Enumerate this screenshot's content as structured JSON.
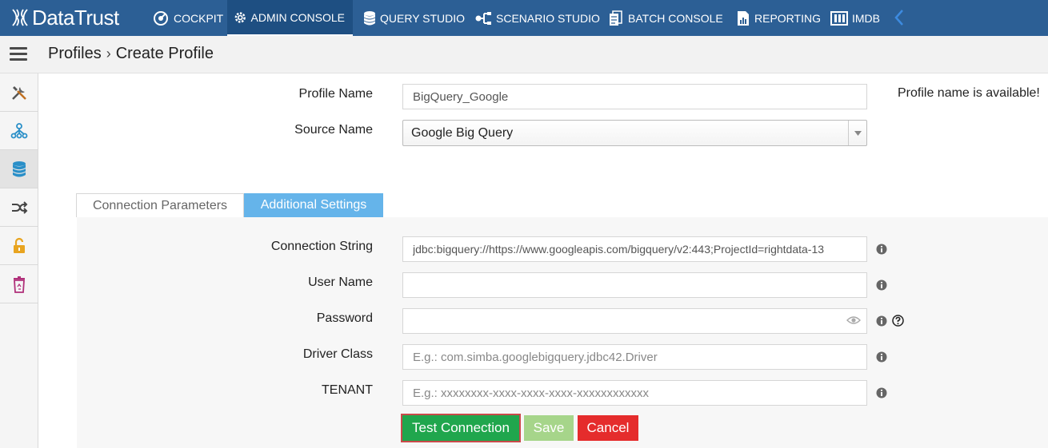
{
  "app": {
    "name": "DataTrust"
  },
  "nav": {
    "items": [
      {
        "label": "COCKPIT",
        "icon": "cockpit-icon",
        "active": false
      },
      {
        "label": "ADMIN CONSOLE",
        "icon": "gear-icon",
        "active": true
      },
      {
        "label": "QUERY STUDIO",
        "icon": "database-icon",
        "active": false
      },
      {
        "label": "SCENARIO STUDIO",
        "icon": "scenario-icon",
        "active": false
      },
      {
        "label": "BATCH CONSOLE",
        "icon": "batch-icon",
        "active": false
      },
      {
        "label": "REPORTING",
        "icon": "report-icon",
        "active": false
      },
      {
        "label": "IMDB",
        "icon": "imdb-icon",
        "active": false
      }
    ]
  },
  "breadcrumb": {
    "parent": "Profiles",
    "separator": "›",
    "current": "Create Profile"
  },
  "sidebar": {
    "items": [
      {
        "icon": "tools-icon"
      },
      {
        "icon": "network-icon"
      },
      {
        "icon": "database-icon",
        "active": true
      },
      {
        "icon": "shuffle-icon"
      },
      {
        "icon": "unlock-icon"
      },
      {
        "icon": "recycle-bin-icon"
      }
    ]
  },
  "form": {
    "profile_name": {
      "label": "Profile Name",
      "value": "BigQuery_Google",
      "status": "Profile name is available!"
    },
    "source_name": {
      "label": "Source Name",
      "value": "Google Big Query"
    }
  },
  "tabs": [
    {
      "label": "Connection Parameters",
      "active": false
    },
    {
      "label": "Additional Settings",
      "active": true
    }
  ],
  "params": {
    "connection_string": {
      "label": "Connection String",
      "value": "jdbc:bigquery://https://www.googleapis.com/bigquery/v2:443;ProjectId=rightdata-13"
    },
    "user_name": {
      "label": "User Name",
      "value": ""
    },
    "password": {
      "label": "Password",
      "value": ""
    },
    "driver_class": {
      "label": "Driver Class",
      "placeholder": "E.g.: com.simba.googlebigquery.jdbc42.Driver"
    },
    "tenant": {
      "label": "TENANT",
      "placeholder": "E.g.: xxxxxxxx-xxxx-xxxx-xxxx-xxxxxxxxxxxx"
    }
  },
  "buttons": {
    "test": "Test Connection",
    "save": "Save",
    "cancel": "Cancel"
  },
  "colors": {
    "nav_bg": "#2c5f95",
    "nav_active": "#1e4f82",
    "tab_active": "#65b4ea",
    "test_btn": "#20a64d",
    "save_btn": "#a6d58a",
    "cancel_btn": "#e52c2c"
  }
}
